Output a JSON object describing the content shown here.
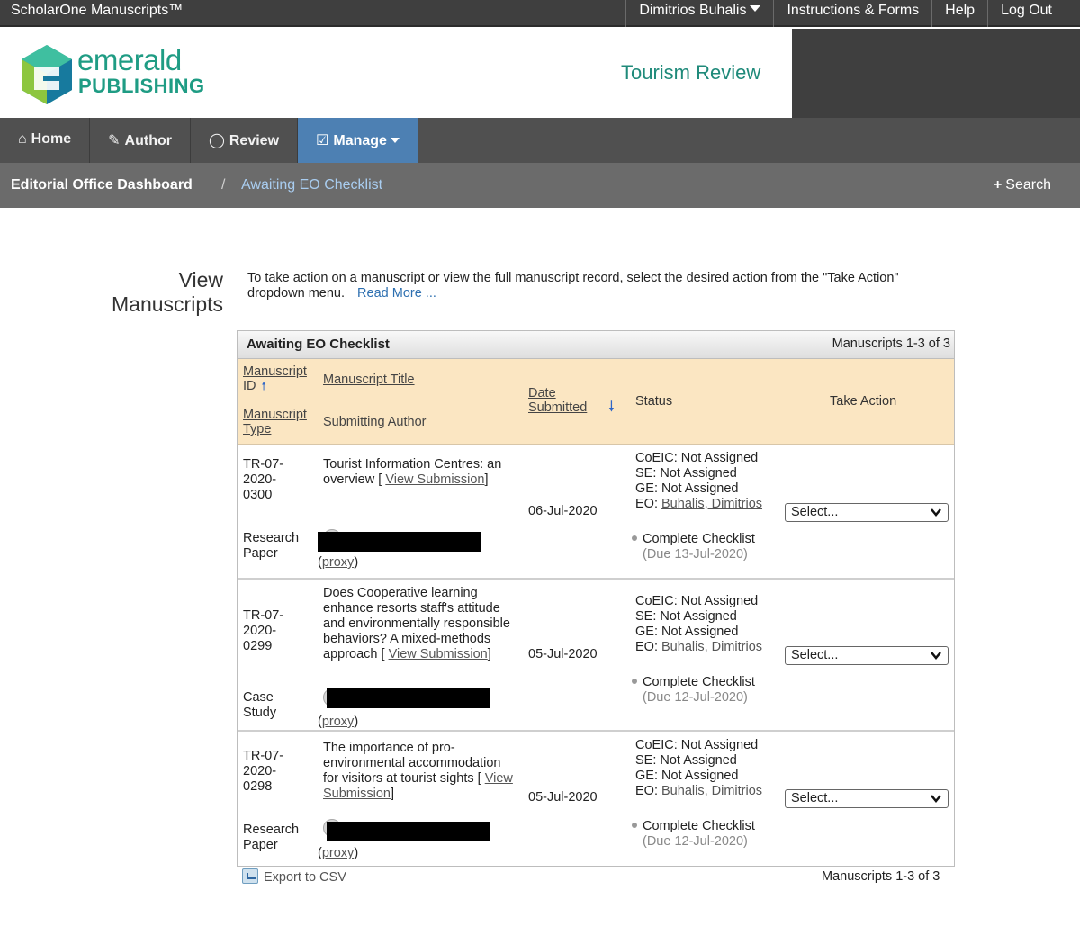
{
  "topbar": {
    "app_name": "ScholarOne Manuscripts™",
    "user_menu": "Dimitrios Buhalis",
    "instructions": "Instructions & Forms",
    "help": "Help",
    "logout": "Log Out"
  },
  "header": {
    "logo_word1": "emerald",
    "logo_word2": "PUBLISHING",
    "journal": "Tourism Review"
  },
  "nav": {
    "home": "Home",
    "author": "Author",
    "review": "Review",
    "manage": "Manage"
  },
  "breadcrumb": {
    "dashboard": "Editorial Office Dashboard",
    "separator": "/",
    "current": "Awaiting EO Checklist",
    "search": "Search"
  },
  "page": {
    "title_line1": "View",
    "title_line2": "Manuscripts",
    "intro": "To take action on a manuscript or view the full manuscript record, select the desired action from the \"Take Action\" dropdown menu.",
    "read_more": "Read More ..."
  },
  "table": {
    "title": "Awaiting EO Checklist",
    "count": "Manuscripts 1-3 of 3",
    "headers": {
      "manuscript_id": "Manuscript ID",
      "manuscript_type": "Manuscript Type",
      "manuscript_title": "Manuscript Title",
      "submitting_author": "Submitting Author",
      "date_submitted": "Date Submitted",
      "status": "Status",
      "take_action": "Take Action"
    },
    "rows": [
      {
        "id_line1": "TR-07-",
        "id_line2": "2020-",
        "id_line3": "0300",
        "type_line1": "Research",
        "type_line2": "Paper",
        "title": "Tourist Information Centres: an overview [",
        "view_submission": "View Submission",
        "proxy": "proxy",
        "date": "06-Jul-2020",
        "coeic": "CoEIC: Not Assigned",
        "se": "SE: Not Assigned",
        "ge": "GE: Not Assigned",
        "eo_label": "EO:",
        "eo_name": "Buhalis, Dimitrios",
        "checklist": "Complete Checklist",
        "due": "(Due 13-Jul-2020)",
        "action": "Select..."
      },
      {
        "id_line1": "TR-07-",
        "id_line2": "2020-",
        "id_line3": "0299",
        "type_line1": "Case",
        "type_line2": "Study",
        "title": "Does Cooperative learning enhance resorts staff's attitude and environmentally responsible behaviors? A mixed-methods approach [",
        "view_submission": "View Submission",
        "proxy": "proxy",
        "date": "05-Jul-2020",
        "coeic": "CoEIC: Not Assigned",
        "se": "SE: Not Assigned",
        "ge": "GE: Not Assigned",
        "eo_label": "EO:",
        "eo_name": "Buhalis, Dimitrios",
        "checklist": "Complete Checklist",
        "due": "(Due 12-Jul-2020)",
        "action": "Select..."
      },
      {
        "id_line1": "TR-07-",
        "id_line2": "2020-",
        "id_line3": "0298",
        "type_line1": "Research",
        "type_line2": "Paper",
        "title": "The importance of pro-environmental accommodation for visitors at tourist sights [",
        "view_submission": "View Submission",
        "proxy": "proxy",
        "date": "05-Jul-2020",
        "coeic": "CoEIC: Not Assigned",
        "se": "SE: Not Assigned",
        "ge": "GE: Not Assigned",
        "eo_label": "EO:",
        "eo_name": "Buhalis, Dimitrios",
        "checklist": "Complete Checklist",
        "due": "(Due 12-Jul-2020)",
        "action": "Select..."
      }
    ]
  },
  "footer": {
    "export": "Export to CSV",
    "count": "Manuscripts 1-3 of 3"
  },
  "colors": {
    "topbar": "#3f3f3f",
    "nav": "#505050",
    "nav_active": "#4d80b3",
    "breadcrumb": "#6b6b6b",
    "column_header": "#fbe6c2",
    "brand": "#1f9c84"
  }
}
